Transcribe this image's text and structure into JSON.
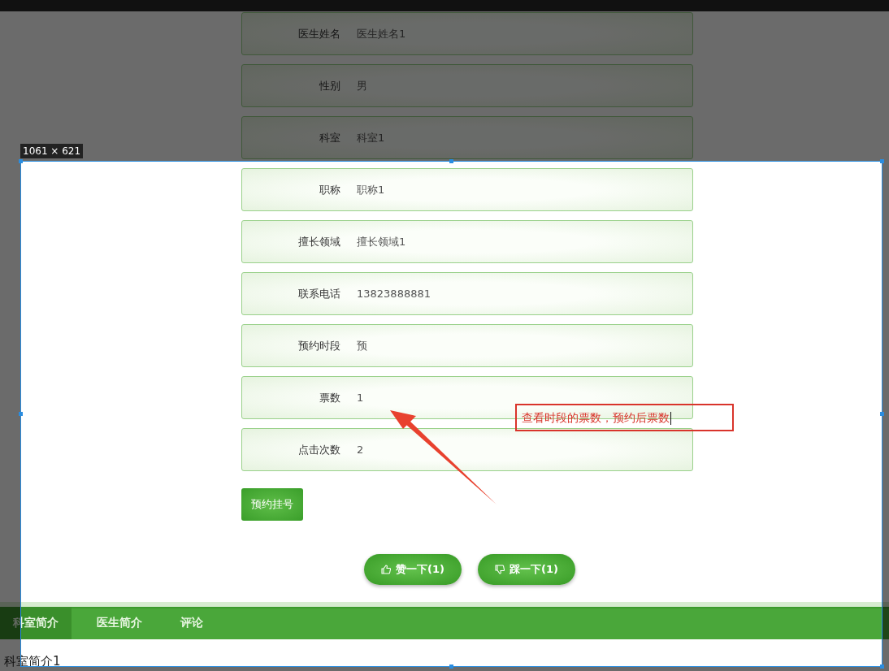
{
  "fields": [
    {
      "label": "医生姓名",
      "value": "医生姓名1"
    },
    {
      "label": "性别",
      "value": "男"
    },
    {
      "label": "科室",
      "value": "科室1"
    },
    {
      "label": "职称",
      "value": "职称1"
    },
    {
      "label": "擅长领域",
      "value": "擅长领域1"
    },
    {
      "label": "联系电话",
      "value": "13823888881"
    },
    {
      "label": "预约时段",
      "value": "预"
    },
    {
      "label": "票数",
      "value": "1"
    },
    {
      "label": "点击次数",
      "value": "2"
    }
  ],
  "book_button": "预约挂号",
  "votes": [
    {
      "kind": "like",
      "label": "赞一下(1)"
    },
    {
      "kind": "dislike",
      "label": "踩一下(1)"
    }
  ],
  "tabs": [
    {
      "label": "科室简介",
      "selected": true
    },
    {
      "label": "医生简介",
      "selected": false
    },
    {
      "label": "评论",
      "selected": false
    }
  ],
  "tab_content": "科室简介1",
  "screenshot_overlay": {
    "size_label": "1061 × 621",
    "annotation": "查看时段的票数，预约后票数"
  }
}
